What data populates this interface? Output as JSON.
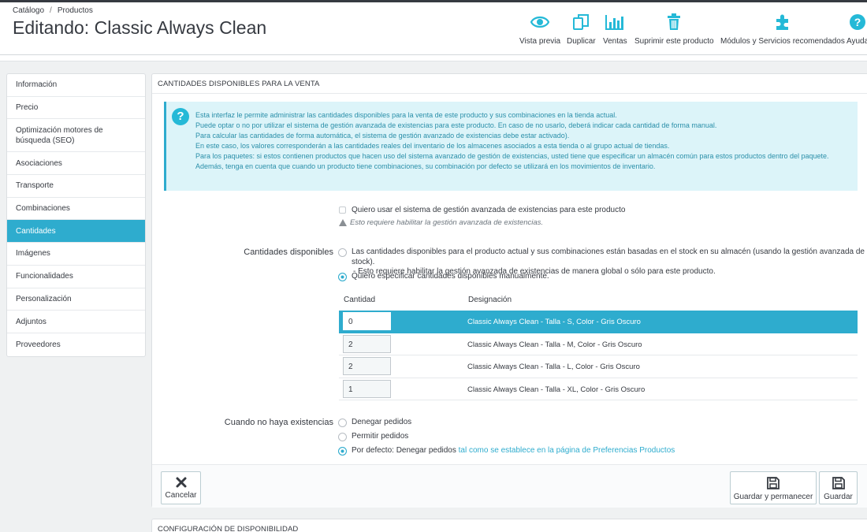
{
  "breadcrumb": [
    "Catálogo",
    "Productos"
  ],
  "title": "Editando: Classic Always Clean",
  "toolbar": [
    {
      "label": "Vista previa",
      "icon": "eye-icon"
    },
    {
      "label": "Duplicar",
      "icon": "copy-icon"
    },
    {
      "label": "Ventas",
      "icon": "bar-chart-icon"
    },
    {
      "label": "Suprimir este producto",
      "icon": "trash-icon"
    },
    {
      "label": "Módulos y Servicios recomendados",
      "icon": "puzzle-icon"
    },
    {
      "label": "Ayuda",
      "icon": "help-icon"
    }
  ],
  "sidebar": {
    "active_index": 6,
    "items": [
      {
        "label": "Información"
      },
      {
        "label": "Precio"
      },
      {
        "label": "Optimización motores de búsqueda (SEO)"
      },
      {
        "label": "Asociaciones"
      },
      {
        "label": "Transporte"
      },
      {
        "label": "Combinaciones"
      },
      {
        "label": "Cantidades"
      },
      {
        "label": "Imágenes"
      },
      {
        "label": "Funcionalidades"
      },
      {
        "label": "Personalización"
      },
      {
        "label": "Adjuntos"
      },
      {
        "label": "Proveedores"
      }
    ]
  },
  "panel": {
    "heading": "Cantidades disponibles para la venta",
    "info_lines": [
      "Esta interfaz le permite administrar las cantidades disponibles para la venta de este producto y sus combinaciones en la tienda actual.",
      "Puede optar o no por utilizar el sistema de gestión avanzada de existencias para este producto. En caso de no usarlo, deberá indicar cada cantidad de forma manual.",
      "Para calcular las cantidades de forma automática, el sistema de gestión avanzado de existencias debe estar activado).",
      "En este caso, los valores corresponderán a las cantidades reales del inventario de los almacenes asociados a esta tienda o al grupo actual de tiendas.",
      "Para los paquetes: si estos contienen productos que hacen uso del sistema avanzado de gestión de existencias, usted tiene que especificar un almacén común para estos productos dentro del paquete.",
      "Además, tenga en cuenta que cuando un producto tiene combinaciones, su combinación por defecto se utilizará en los movimientos de inventario."
    ],
    "advanced_stock_checkbox": "Quiero usar el sistema de gestión avanzada de existencias para este producto",
    "advanced_stock_checked": false,
    "advanced_stock_warning": "Esto requiere habilitar la gestión avanzada de existencias.",
    "available_label": "Cantidades disponibles",
    "available_options": [
      {
        "line1": "Las cantidades disponibles para el producto actual y sus combinaciones están basadas en el stock en su almacén (usando la gestión avanzada de stock).",
        "line2": "- Esto requiere habilitar la gestión avanzada de existencias de manera global o sólo para este producto.",
        "selected": false
      },
      {
        "line1": "Quiero especificar cantidades disponibles manualmente.",
        "line2": "",
        "selected": true
      }
    ],
    "table": {
      "headers": [
        "Cantidad",
        "Designación"
      ],
      "selected_index": 0,
      "rows": [
        {
          "quantity": "0",
          "designation": "Classic Always Clean - Talla - S, Color - Gris Oscuro"
        },
        {
          "quantity": "2",
          "designation": "Classic Always Clean - Talla - M, Color - Gris Oscuro"
        },
        {
          "quantity": "2",
          "designation": "Classic Always Clean - Talla - L, Color - Gris Oscuro"
        },
        {
          "quantity": "1",
          "designation": "Classic Always Clean - Talla - XL, Color - Gris Oscuro"
        }
      ]
    },
    "out_of_stock_label": "Cuando no haya existencias",
    "out_of_stock_options": [
      {
        "label": "Denegar pedidos",
        "link": "",
        "selected": false
      },
      {
        "label": "Permitir pedidos",
        "link": "",
        "selected": false
      },
      {
        "label": "Por defecto: Denegar pedidos",
        "link": "tal como se establece en la página de Preferencias Productos",
        "selected": true
      }
    ],
    "footer": {
      "cancel": "Cancelar",
      "save_stay": "Guardar y permanecer",
      "save": "Guardar"
    }
  },
  "panel2": {
    "heading": "Configuración de disponibilidad"
  },
  "colors": {
    "accent": "#2eacce",
    "info_bg": "#dcf4f9",
    "info_text": "#2a8fa9"
  }
}
